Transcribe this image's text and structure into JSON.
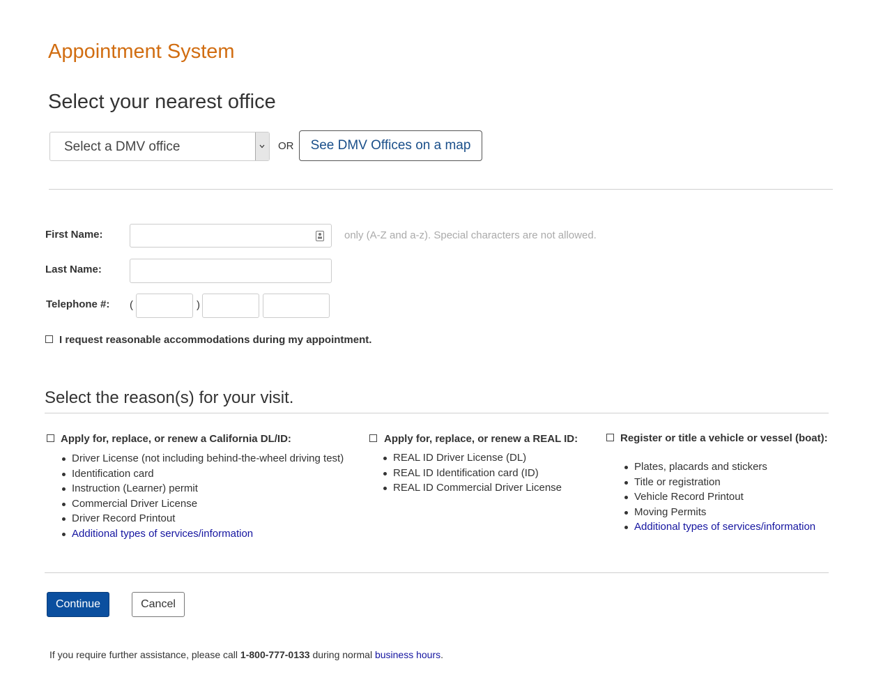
{
  "app_title": "Appointment System",
  "office": {
    "heading": "Select your nearest office",
    "select_value": "Select a DMV office",
    "or_text": "OR",
    "map_button": "See DMV Offices on a map"
  },
  "form": {
    "first_name_label": "First Name:",
    "first_name_value": "",
    "first_name_hint": "only (A-Z and a-z). Special characters  are not allowed.",
    "last_name_label": "Last Name:",
    "last_name_value": "",
    "telephone_label": "Telephone #:",
    "paren_open": "(",
    "paren_close": ")",
    "accommodation_label": "I request reasonable accommodations during my appointment.",
    "accommodation_checked": false
  },
  "reasons": {
    "heading": "Select the reason(s) for your visit.",
    "groups": [
      {
        "title": "Apply for, replace, or renew a California DL/ID:",
        "checked": false,
        "items": [
          "Driver License (not including behind-the-wheel driving test)",
          "Identification card",
          "Instruction (Learner) permit",
          "Commercial Driver License",
          "Driver Record Printout"
        ],
        "link": "Additional types of services/information"
      },
      {
        "title": "Apply for, replace, or renew a REAL ID:",
        "checked": false,
        "items": [
          "REAL ID Driver License (DL)",
          "REAL ID Identification card (ID)",
          "REAL ID Commercial Driver License"
        ]
      },
      {
        "title": "Register or title a vehicle or vessel (boat):",
        "checked": false,
        "items": [
          "Plates, placards and stickers",
          "Title or registration",
          "Vehicle Record Printout",
          "Moving Permits"
        ],
        "link": "Additional types of services/information"
      }
    ]
  },
  "buttons": {
    "continue": "Continue",
    "cancel": "Cancel"
  },
  "footer": {
    "prefix": "If you require further assistance, please call ",
    "phone": "1-800-777-0133",
    "middle": " during normal ",
    "link": "business hours",
    "suffix": "."
  },
  "colors": {
    "title": "#d16d11",
    "primary_button": "#0b4f9f",
    "link": "#1515a0",
    "map_button_text": "#1a4f8a",
    "hint": "#aaaaaa"
  }
}
